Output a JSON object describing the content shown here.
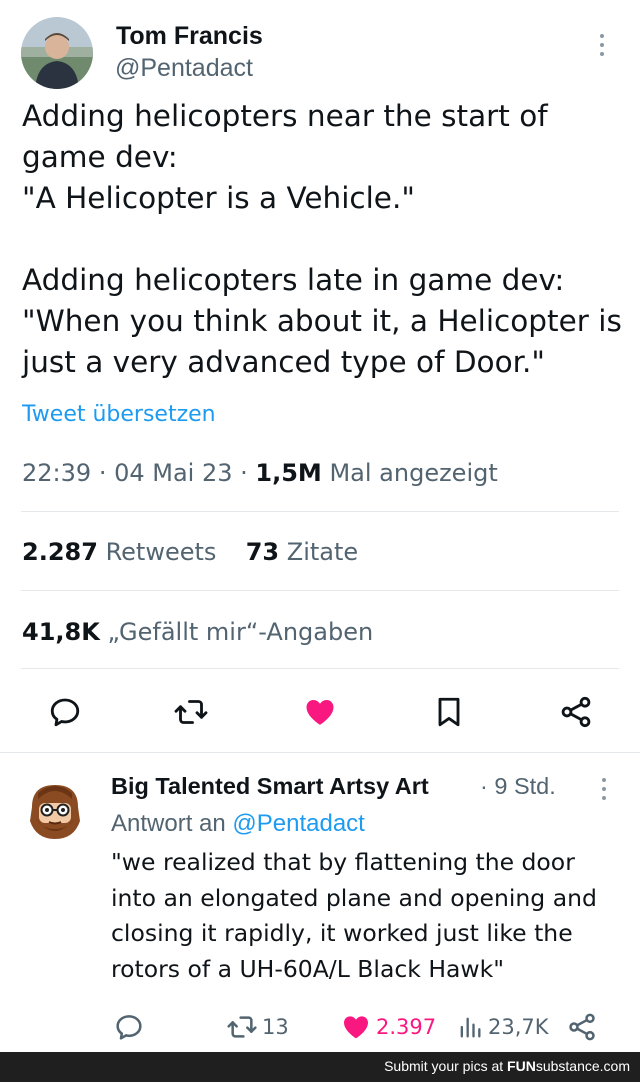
{
  "colors": {
    "accent": "#1d9bf0",
    "like": "#f91880",
    "muted": "#536471",
    "text": "#0f1419",
    "footer_bg": "#1f1f1f"
  },
  "tweet": {
    "author_name": "Tom Francis",
    "author_handle": "@Pentadact",
    "paragraph_1": "Adding helicopters near the start of\ngame dev:\n\"A Helicopter is a Vehicle.\"",
    "paragraph_2": "Adding helicopters late in game dev:\n\"When you think about it, a Helicopter is\njust a very advanced type of Door.\"",
    "translate_link": "Tweet übersetzen",
    "time": "22:39",
    "date": "04 Mai 23",
    "views_count": "1,5M",
    "views_label": "Mal angezeigt",
    "retweets_count": "2.287",
    "retweets_label": "Retweets",
    "quotes_count": "73",
    "quotes_label": "Zitate",
    "likes_count": "41,8K",
    "likes_label": "„Gefällt mir“-Angaben",
    "actions": [
      "reply-icon",
      "retweet-icon",
      "heart-icon",
      "bookmark-icon",
      "share-icon"
    ]
  },
  "reply": {
    "author_name": "Big Talented Smart Artsy Art",
    "time": "9 Std.",
    "reply_prefix": "Antwort an",
    "reply_mention": "@Pentadact",
    "text": "\"we realized that by flattening the door into an elongated plane and opening and closing it rapidly, it worked just like the rotors of a UH-60A/L Black Hawk\"",
    "retweets": "13",
    "likes": "2.397",
    "views": "23,7K"
  },
  "footer": {
    "text": "Submit your pics at",
    "brand_bold": "FUN",
    "brand_rest": "substance.com"
  }
}
